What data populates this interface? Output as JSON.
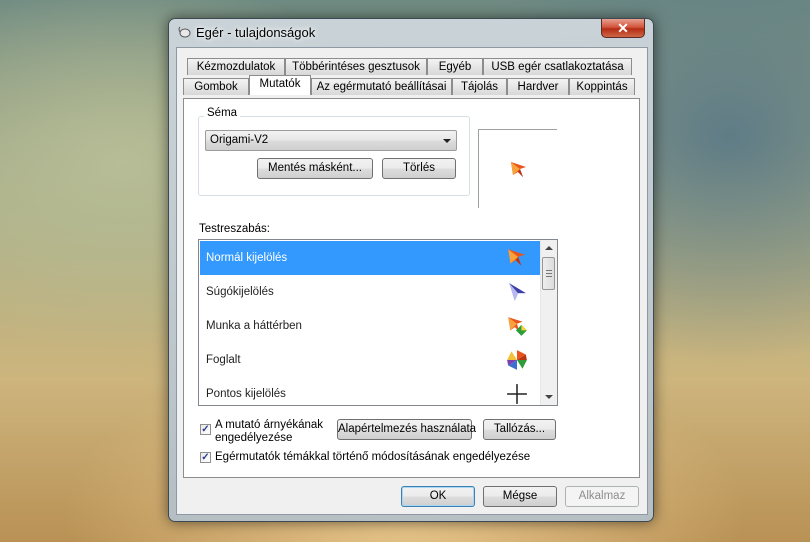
{
  "window": {
    "title": "Egér - tulajdonságok",
    "close_glyph": "✕"
  },
  "tabs_row1": [
    "Kézmozdulatok",
    "Többérintéses gesztusok",
    "Egyéb",
    "USB egér csatlakoztatása"
  ],
  "tabs_row2": [
    "Gombok",
    "Mutatók",
    "Az egérmutató beállításai",
    "Tájolás",
    "Hardver",
    "Koppintás"
  ],
  "scheme": {
    "group_label": "Séma",
    "selected": "Origami-V2",
    "save_as_label": "Mentés másként...",
    "delete_label": "Törlés"
  },
  "customize": {
    "label": "Testreszabás:",
    "items": [
      {
        "label": "Normál kijelölés",
        "icon": "normal-select-cursor-icon"
      },
      {
        "label": "Súgókijelölés",
        "icon": "help-select-cursor-icon"
      },
      {
        "label": "Munka a háttérben",
        "icon": "working-background-cursor-icon"
      },
      {
        "label": "Foglalt",
        "icon": "busy-cursor-icon"
      },
      {
        "label": "Pontos kijelölés",
        "icon": "precision-select-cursor-icon"
      }
    ]
  },
  "shadow_checkbox": {
    "label": "A mutató árnyékának engedélyezése",
    "checked": true
  },
  "use_default_label": "Alapértelmezés használata",
  "browse_label": "Tallózás...",
  "theme_checkbox": {
    "label": "Egérmutatók témákkal történő módosításának engedélyezése",
    "checked": true
  },
  "footer": {
    "ok": "OK",
    "cancel": "Mégse",
    "apply": "Alkalmaz"
  },
  "colors": {
    "selection": "#3399ff",
    "close_button": "#c7402a",
    "cursor_orange": "#e8541c"
  }
}
